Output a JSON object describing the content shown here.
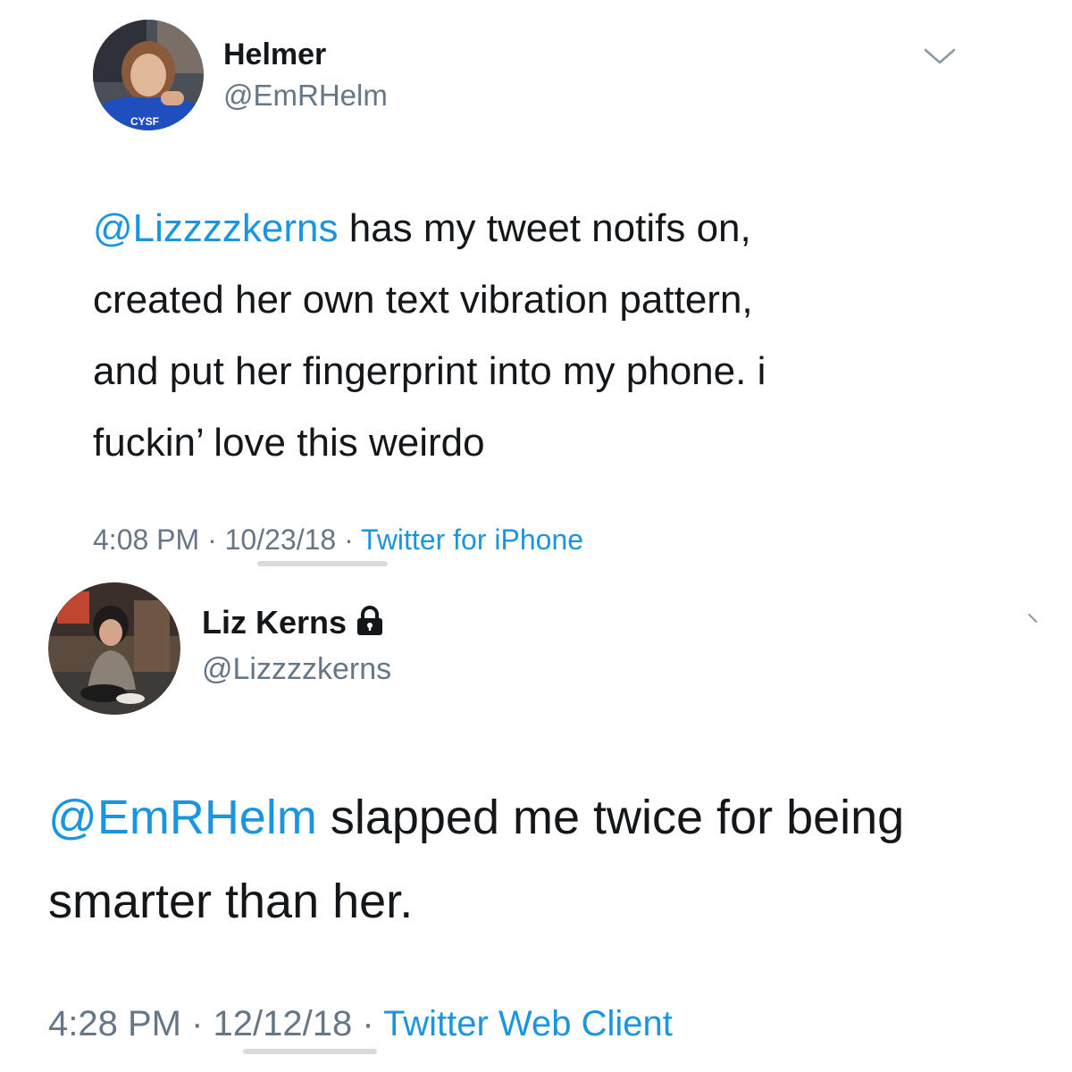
{
  "tweets": [
    {
      "name": "Helmer",
      "handle": "@EmRHelm",
      "mention": "@Lizzzzkerns",
      "text_lines": [
        " has my tweet notifs on,",
        "created her own text vibration pattern,",
        "and put her fingerprint into my phone. i",
        "fuckin’ love this weirdo"
      ],
      "time": "4:08 PM",
      "date": "10/23/18",
      "source": "Twitter for iPhone",
      "separator": " · ",
      "avatar_icon": "profile-photo-icon",
      "menu_icon": "chevron-down-icon"
    },
    {
      "name": "Liz Kerns",
      "handle": "@Lizzzzkerns",
      "mention": "@EmRHelm",
      "text_lines": [
        " slapped me twice for being",
        "smarter than her."
      ],
      "time": "4:28 PM",
      "date": "12/12/18",
      "source": "Twitter Web Client",
      "separator": " · ",
      "avatar_icon": "profile-photo-icon",
      "protected_icon": "lock-icon",
      "menu_icon": "chevron-down-icon"
    }
  ],
  "colors": {
    "link": "#1b95e0",
    "secondary": "#657786",
    "text": "#14171a"
  }
}
